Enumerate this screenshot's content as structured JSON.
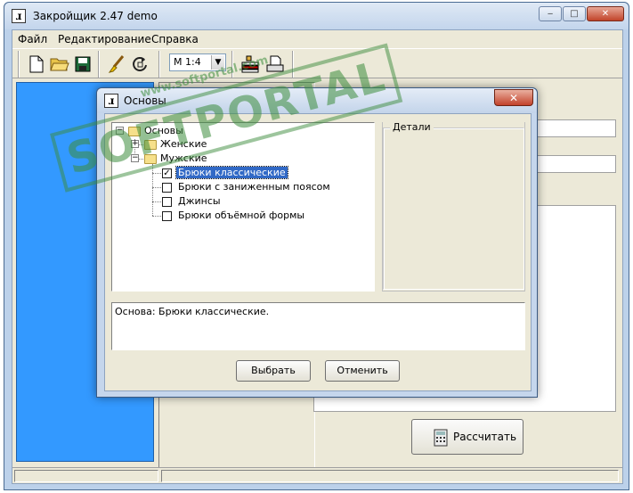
{
  "window": {
    "title": "Закройщик 2.47 demo",
    "minimize": "‒",
    "maximize": "□",
    "close": "✕"
  },
  "menu": {
    "file": "Файл",
    "edit": "Редактирование",
    "help": "Справка"
  },
  "toolbar": {
    "scale_select": "М 1:4",
    "scale_arrow": "▼"
  },
  "calc_button": {
    "label": "Рассчитать"
  },
  "dialog": {
    "title": "Основы",
    "close": "✕",
    "tree": {
      "root": "Основы",
      "groups": [
        {
          "label": "Женские",
          "expanded": false
        },
        {
          "label": "Мужские",
          "expanded": true
        }
      ],
      "items": [
        {
          "label": "Брюки классические",
          "checked": true,
          "selected": true
        },
        {
          "label": "Брюки с заниженным поясом",
          "checked": false
        },
        {
          "label": "Джинсы",
          "checked": false
        },
        {
          "label": "Брюки объёмной формы",
          "checked": false
        }
      ]
    },
    "details_label": "Детали",
    "description": "Основа: Брюки классические.",
    "select_button": "Выбрать",
    "cancel_button": "Отменить"
  },
  "watermark": {
    "brand": "SOFTPORTAL",
    "url": "www.softportal.com"
  }
}
